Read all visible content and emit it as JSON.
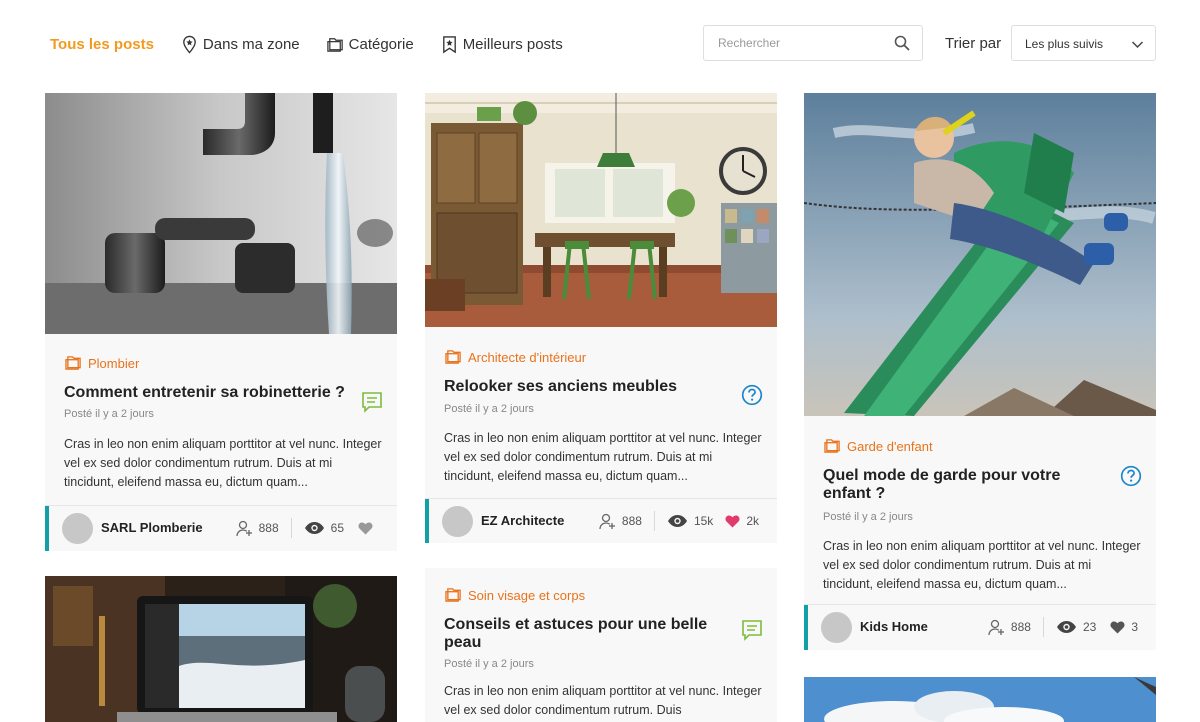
{
  "nav": {
    "tabs": [
      {
        "label": "Tous les posts",
        "icon": "",
        "active": true
      },
      {
        "label": "Dans ma zone",
        "icon": "location-pin-icon",
        "active": false
      },
      {
        "label": "Catégorie",
        "icon": "folder-icon",
        "active": false
      },
      {
        "label": "Meilleurs posts",
        "icon": "star-bookmark-icon",
        "active": false
      }
    ],
    "search_placeholder": "Rechercher",
    "sort_label": "Trier par",
    "sort_value": "Les plus suivis"
  },
  "colors": {
    "accent_active_tab": "#f29a1f",
    "category": "#e8731c",
    "author_bar": "#139fa6",
    "heart_liked": "#e23b6b",
    "question_icon": "#1d86c8",
    "comment_icon": "#7cbd3e"
  },
  "posts": [
    {
      "category": "Plombier",
      "title": "Comment entretenir sa robinetterie ?",
      "posted": "Posté il y a 2 jours",
      "excerpt": "Cras in leo non enim aliquam porttitor at vel nunc. Integer vel ex sed dolor condimentum rutrum. Duis at mi tincidunt, eleifend massa eu, dictum quam...",
      "type_icon": "comment-icon",
      "image": "faucet-photo",
      "author": "SARL Plomberie",
      "followers": "888",
      "views": "65",
      "likes": "",
      "liked": false
    },
    {
      "category": "Architecte d'intérieur",
      "title": "Relooker ses anciens meubles",
      "posted": "Posté il y a 2 jours",
      "excerpt": "Cras in leo non enim aliquam porttitor at vel nunc. Integer vel ex sed dolor condimentum rutrum. Duis at mi tincidunt, eleifend massa eu, dictum quam...",
      "type_icon": "question-icon",
      "image": "kitchen-photo",
      "author": "EZ Architecte",
      "followers": "888",
      "views": "15k",
      "likes": "2k",
      "liked": true
    },
    {
      "category": "Garde d'enfant",
      "title": "Quel mode de garde pour votre enfant ?",
      "posted": "Posté il y a 2 jours",
      "excerpt": "Cras in leo non enim aliquam porttitor at vel nunc. Integer vel ex sed dolor condimentum rutrum. Duis at mi tincidunt, eleifend massa eu, dictum quam...",
      "type_icon": "question-icon",
      "image": "swing-photo",
      "author": "Kids Home",
      "followers": "888",
      "views": "23",
      "likes": "3",
      "liked": false
    },
    {
      "category": "Soin visage et corps",
      "title": "Conseils et astuces pour une belle peau",
      "posted": "Posté il y a 2 jours",
      "excerpt": "Cras in leo non enim aliquam porttitor at vel nunc. Integer vel ex sed dolor condimentum rutrum. Duis",
      "type_icon": "comment-icon",
      "image": "",
      "author": "",
      "followers": "",
      "views": "",
      "likes": "",
      "liked": false
    }
  ],
  "more_images": [
    "laptop-photo",
    "sky-clouds-photo"
  ]
}
